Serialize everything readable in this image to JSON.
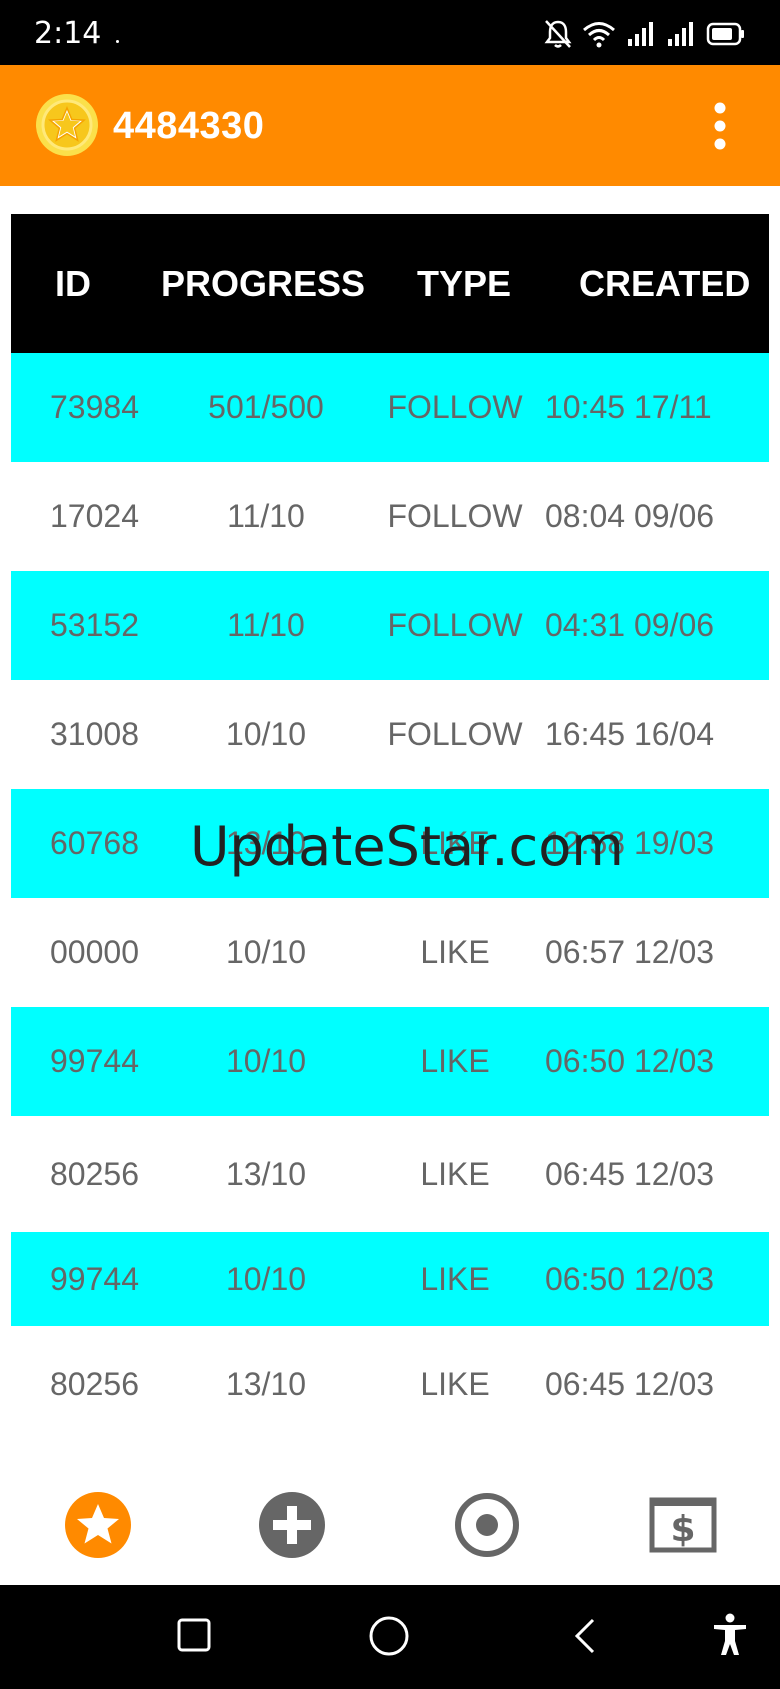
{
  "status_bar": {
    "time": "2:14"
  },
  "app_bar": {
    "coin_count": "4484330"
  },
  "table": {
    "headers": [
      "ID",
      "PROGRESS",
      "TYPE",
      "CREATED"
    ],
    "rows": [
      {
        "id": "73984",
        "progress": "501/500",
        "type": "FOLLOW",
        "created": "10:45 17/11"
      },
      {
        "id": "17024",
        "progress": "11/10",
        "type": "FOLLOW",
        "created": "08:04 09/06"
      },
      {
        "id": "53152",
        "progress": "11/10",
        "type": "FOLLOW",
        "created": "04:31 09/06"
      },
      {
        "id": "31008",
        "progress": "10/10",
        "type": "FOLLOW",
        "created": "16:45 16/04"
      },
      {
        "id": "60768",
        "progress": "13/10",
        "type": "LIKE",
        "created": "12:58 19/03"
      },
      {
        "id": "00000",
        "progress": "10/10",
        "type": "LIKE",
        "created": "06:57 12/03"
      },
      {
        "id": "99744",
        "progress": "10/10",
        "type": "LIKE",
        "created": "06:50 12/03"
      },
      {
        "id": "80256",
        "progress": "13/10",
        "type": "LIKE",
        "created": "06:45 12/03"
      },
      {
        "id": "99744",
        "progress": "10/10",
        "type": "LIKE",
        "created": "06:50 12/03"
      },
      {
        "id": "80256",
        "progress": "13/10",
        "type": "LIKE",
        "created": "06:45 12/03"
      }
    ]
  },
  "watermark": "UpdateStar.com",
  "colors": {
    "accent": "#ff8a00",
    "row_highlight": "#00ffff",
    "header_bg": "#000000",
    "nav_grey": "#666666"
  },
  "bottom_nav": [
    "star-icon",
    "plus-icon",
    "target-icon",
    "dollar-bill-icon"
  ],
  "system_nav": [
    "recents-icon",
    "home-icon",
    "back-icon",
    "accessibility-icon"
  ]
}
